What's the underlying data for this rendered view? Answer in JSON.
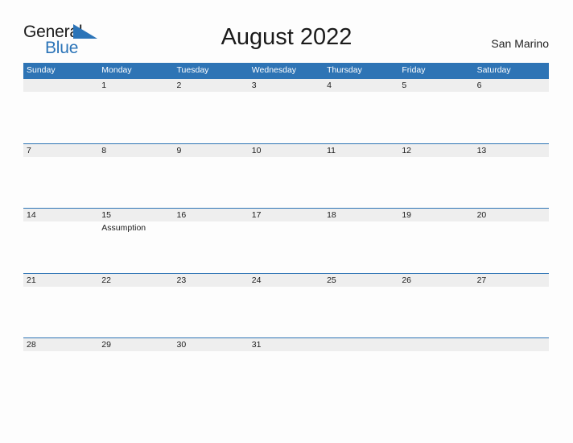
{
  "brand": {
    "logo_primary": "General",
    "logo_secondary": "Blue",
    "flag_icon": "blue-flag-triangle-icon",
    "primary_color": "#1a1a1a",
    "secondary_color": "#2b74b8"
  },
  "header": {
    "title": "August 2022",
    "location": "San Marino"
  },
  "theme": {
    "header_blue": "#2e74b5",
    "band_gray": "#eeeeee",
    "page_background": "#fdfdfd",
    "text_color": "#202020"
  },
  "calendar": {
    "month": "August",
    "year": "2022",
    "weekday_headers": [
      "Sunday",
      "Monday",
      "Tuesday",
      "Wednesday",
      "Thursday",
      "Friday",
      "Saturday"
    ],
    "weeks": [
      {
        "days": [
          {
            "num": "",
            "event": ""
          },
          {
            "num": "1",
            "event": ""
          },
          {
            "num": "2",
            "event": ""
          },
          {
            "num": "3",
            "event": ""
          },
          {
            "num": "4",
            "event": ""
          },
          {
            "num": "5",
            "event": ""
          },
          {
            "num": "6",
            "event": ""
          }
        ]
      },
      {
        "days": [
          {
            "num": "7",
            "event": ""
          },
          {
            "num": "8",
            "event": ""
          },
          {
            "num": "9",
            "event": ""
          },
          {
            "num": "10",
            "event": ""
          },
          {
            "num": "11",
            "event": ""
          },
          {
            "num": "12",
            "event": ""
          },
          {
            "num": "13",
            "event": ""
          }
        ]
      },
      {
        "days": [
          {
            "num": "14",
            "event": ""
          },
          {
            "num": "15",
            "event": "Assumption"
          },
          {
            "num": "16",
            "event": ""
          },
          {
            "num": "17",
            "event": ""
          },
          {
            "num": "18",
            "event": ""
          },
          {
            "num": "19",
            "event": ""
          },
          {
            "num": "20",
            "event": ""
          }
        ]
      },
      {
        "days": [
          {
            "num": "21",
            "event": ""
          },
          {
            "num": "22",
            "event": ""
          },
          {
            "num": "23",
            "event": ""
          },
          {
            "num": "24",
            "event": ""
          },
          {
            "num": "25",
            "event": ""
          },
          {
            "num": "26",
            "event": ""
          },
          {
            "num": "27",
            "event": ""
          }
        ]
      },
      {
        "days": [
          {
            "num": "28",
            "event": ""
          },
          {
            "num": "29",
            "event": ""
          },
          {
            "num": "30",
            "event": ""
          },
          {
            "num": "31",
            "event": ""
          },
          {
            "num": "",
            "event": ""
          },
          {
            "num": "",
            "event": ""
          },
          {
            "num": "",
            "event": ""
          }
        ]
      }
    ]
  }
}
